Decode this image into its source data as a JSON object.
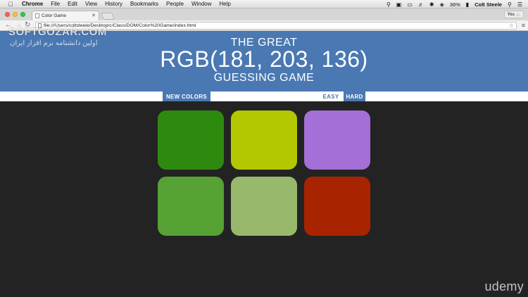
{
  "menubar": {
    "items": [
      "Chrome",
      "File",
      "Edit",
      "View",
      "History",
      "Bookmarks",
      "People",
      "Window",
      "Help"
    ],
    "battery": "36%",
    "user": "Colt Steele"
  },
  "browser": {
    "tab_title": "Color Game",
    "profile_label": "You",
    "url": "file:///Users/coltsteele/Desktop/c/Class/DOM/Color%20Game/index.html"
  },
  "watermark": {
    "brand": "SOFTGOZAR.COM",
    "subtitle": "اولین دانشنامه نرم افزار ایران"
  },
  "game": {
    "title_top": "THE GREAT",
    "rgb_display": "RGB(181, 203, 136)",
    "title_bottom": "GUESSING GAME",
    "new_colors_label": "NEW COLORS",
    "easy_label": "EASY",
    "hard_label": "HARD",
    "header_color": "#4a78b2",
    "background_color": "#232323",
    "squares": [
      {
        "color": "#2e8a0e"
      },
      {
        "color": "#b3c800"
      },
      {
        "color": "#a46fd6"
      },
      {
        "color": "#56a234"
      },
      {
        "color": "#98b96c"
      },
      {
        "color": "#a82300"
      }
    ]
  },
  "corner_logo": "udemy"
}
